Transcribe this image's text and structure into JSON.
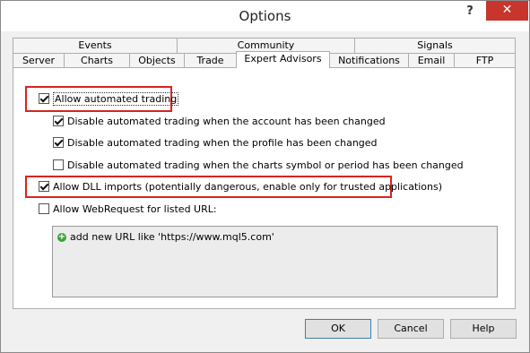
{
  "window": {
    "title": "Options",
    "help_label": "?",
    "close_label": "✕"
  },
  "tabs_row1": [
    "Events",
    "Community",
    "Signals"
  ],
  "tabs_row2": [
    "Server",
    "Charts",
    "Objects",
    "Trade",
    "Expert Advisors",
    "Notifications",
    "Email",
    "FTP"
  ],
  "active_tab": "Expert Advisors",
  "options": {
    "allow_automated_trading": {
      "label": "Allow automated trading",
      "checked": true
    },
    "disable_account_changed": {
      "label": "Disable automated trading when the account has been changed",
      "checked": true
    },
    "disable_profile_changed": {
      "label": "Disable automated trading when the profile has been changed",
      "checked": true
    },
    "disable_symbol_changed": {
      "label": "Disable automated trading when the charts symbol or period has been changed",
      "checked": false
    },
    "allow_dll_imports": {
      "label": "Allow DLL imports (potentially dangerous, enable only for trusted applications)",
      "checked": true
    },
    "allow_webrequest": {
      "label": "Allow WebRequest for listed URL:",
      "checked": false
    }
  },
  "url_list": {
    "add_label": "add new URL like 'https://www.mql5.com'"
  },
  "buttons": {
    "ok": "OK",
    "cancel": "Cancel",
    "help": "Help"
  },
  "colors": {
    "highlight": "#d9231f",
    "close_button": "#c7352c",
    "add_icon": "#3aa23a"
  }
}
